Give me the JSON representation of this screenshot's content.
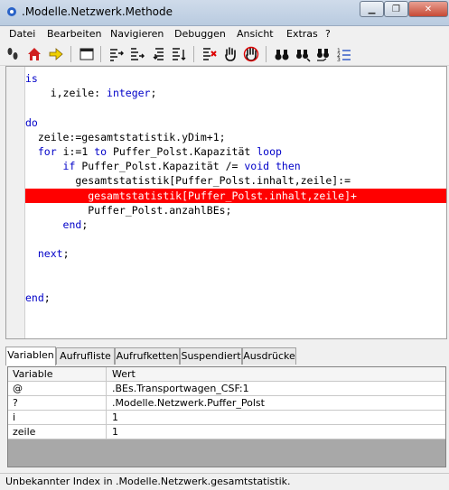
{
  "window": {
    "title": ".Modelle.Netzwerk.Methode",
    "min_label": "▁",
    "max_label": "❐",
    "close_label": "✕"
  },
  "menu": [
    "Datei",
    "Bearbeiten",
    "Navigieren",
    "Debuggen",
    "Ansicht",
    "Extras",
    "?"
  ],
  "toolbar": [
    "footsteps-icon",
    "home-icon",
    "arrow-icon",
    "window-icon",
    "step-into-icon",
    "step-over-icon",
    "step-back-icon",
    "step-out-icon",
    "breakpoint-icon",
    "hand-icon",
    "stop-hand-icon",
    "binoculars-icon",
    "find-replace-icon",
    "find-next-icon",
    "line-numbers-icon"
  ],
  "code": [
    [
      {
        "t": "is",
        "k": 1
      }
    ],
    [
      {
        "t": "    i,zeile: "
      },
      {
        "t": "integer",
        "k": 1
      },
      {
        "t": ";"
      }
    ],
    [
      {
        "t": ""
      }
    ],
    [
      {
        "t": "do",
        "k": 1
      }
    ],
    [
      {
        "t": "  zeile:=gesamtstatistik.yDim+1;"
      }
    ],
    [
      {
        "t": "  "
      },
      {
        "t": "for",
        "k": 1
      },
      {
        "t": " i:=1 "
      },
      {
        "t": "to",
        "k": 1
      },
      {
        "t": " Puffer_Polst.Kapazität "
      },
      {
        "t": "loop",
        "k": 1
      }
    ],
    [
      {
        "t": "      "
      },
      {
        "t": "if",
        "k": 1
      },
      {
        "t": " Puffer_Polst.Kapazität /= "
      },
      {
        "t": "void",
        "k": 1
      },
      {
        "t": " "
      },
      {
        "t": "then",
        "k": 1
      }
    ],
    [
      {
        "t": "        gesamtstatistik[Puffer_Polst.inhalt,zeile]:="
      }
    ],
    [
      {
        "t": "          gesamtstatistik[Puffer_Polst.inhalt,zeile]+"
      }
    ],
    [
      {
        "t": "          Puffer_Polst.anzahlBEs;"
      }
    ],
    [
      {
        "t": "      "
      },
      {
        "t": "end",
        "k": 1
      },
      {
        "t": ";"
      }
    ],
    [
      {
        "t": ""
      }
    ],
    [
      {
        "t": "  "
      },
      {
        "t": "next",
        "k": 1
      },
      {
        "t": ";"
      }
    ],
    [
      {
        "t": ""
      }
    ],
    [
      {
        "t": ""
      }
    ],
    [
      {
        "t": "end",
        "k": 1
      },
      {
        "t": ";"
      }
    ]
  ],
  "highlight_line": 8,
  "tabs": [
    "Variablen",
    "Aufrufliste",
    "Aufrufketten",
    "Suspendiert",
    "Ausdrücke"
  ],
  "variables": {
    "headers": [
      "Variable",
      "Wert"
    ],
    "rows": [
      [
        "@",
        ".BEs.Transportwagen_CSF:1"
      ],
      [
        "?",
        ".Modelle.Netzwerk.Puffer_Polst"
      ],
      [
        "i",
        "1"
      ],
      [
        "zeile",
        "1"
      ]
    ]
  },
  "status": "Unbekannter Index in .Modelle.Netzwerk.gesamtstatistik.",
  "colors": {
    "keyword": "#0000c8",
    "highlight": "#ff0000"
  }
}
